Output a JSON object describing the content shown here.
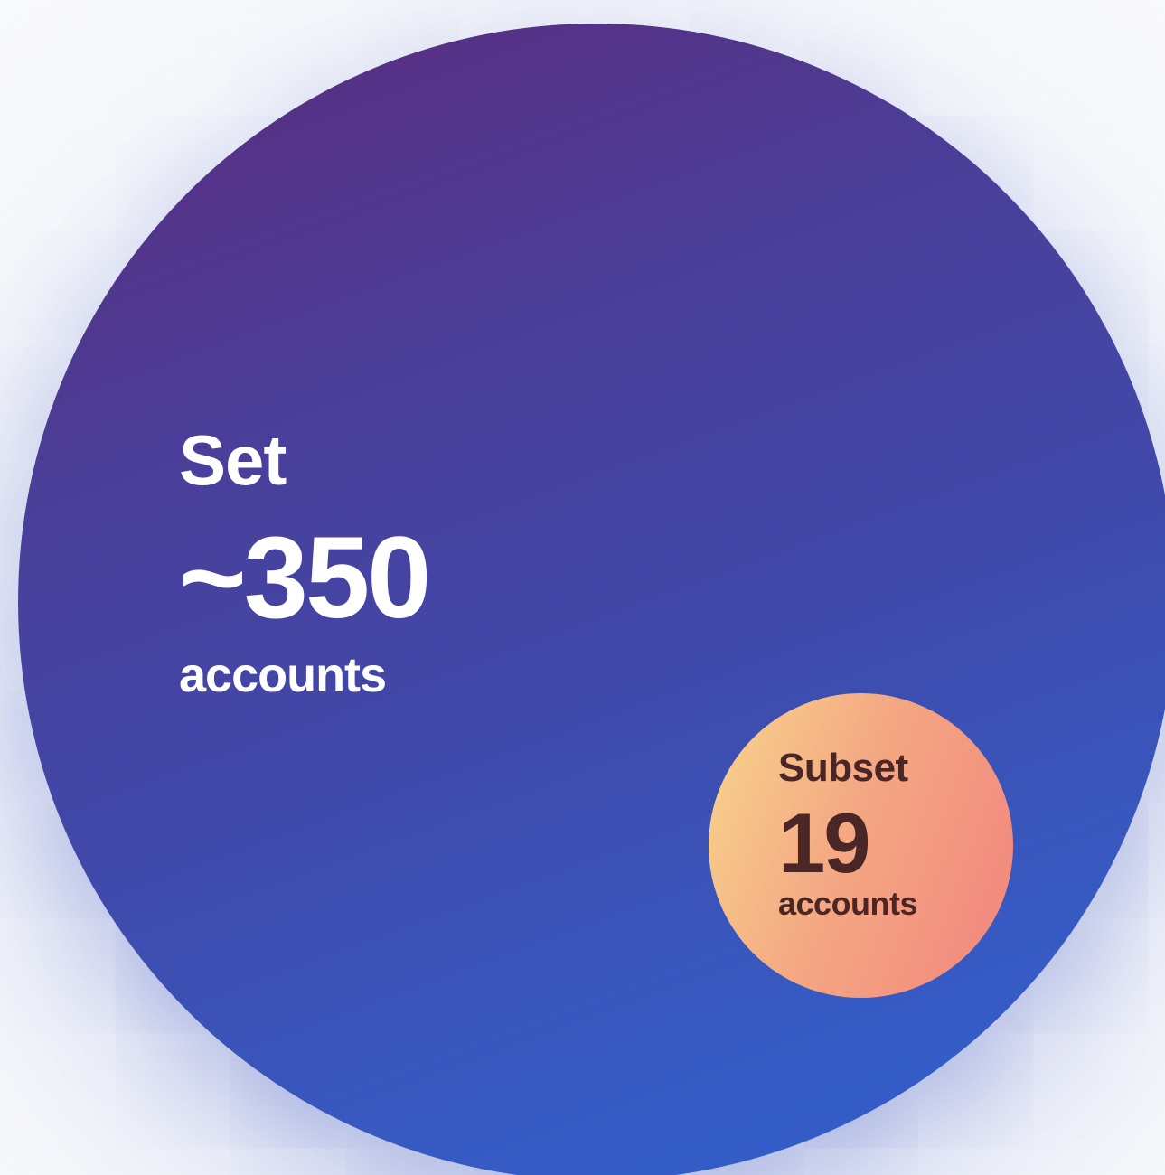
{
  "set": {
    "label": "Set",
    "count": "~350",
    "unit": "accounts",
    "approx_value": 350,
    "colors": {
      "gradient_top": "#5b2a7c",
      "gradient_bottom": "#2f5fcc",
      "text": "#ffffff"
    }
  },
  "subset": {
    "label": "Subset",
    "count": "19",
    "unit": "accounts",
    "value": 19,
    "colors": {
      "gradient_left": "#f8d58c",
      "gradient_right": "#f2847e",
      "text": "#4a2626"
    }
  }
}
